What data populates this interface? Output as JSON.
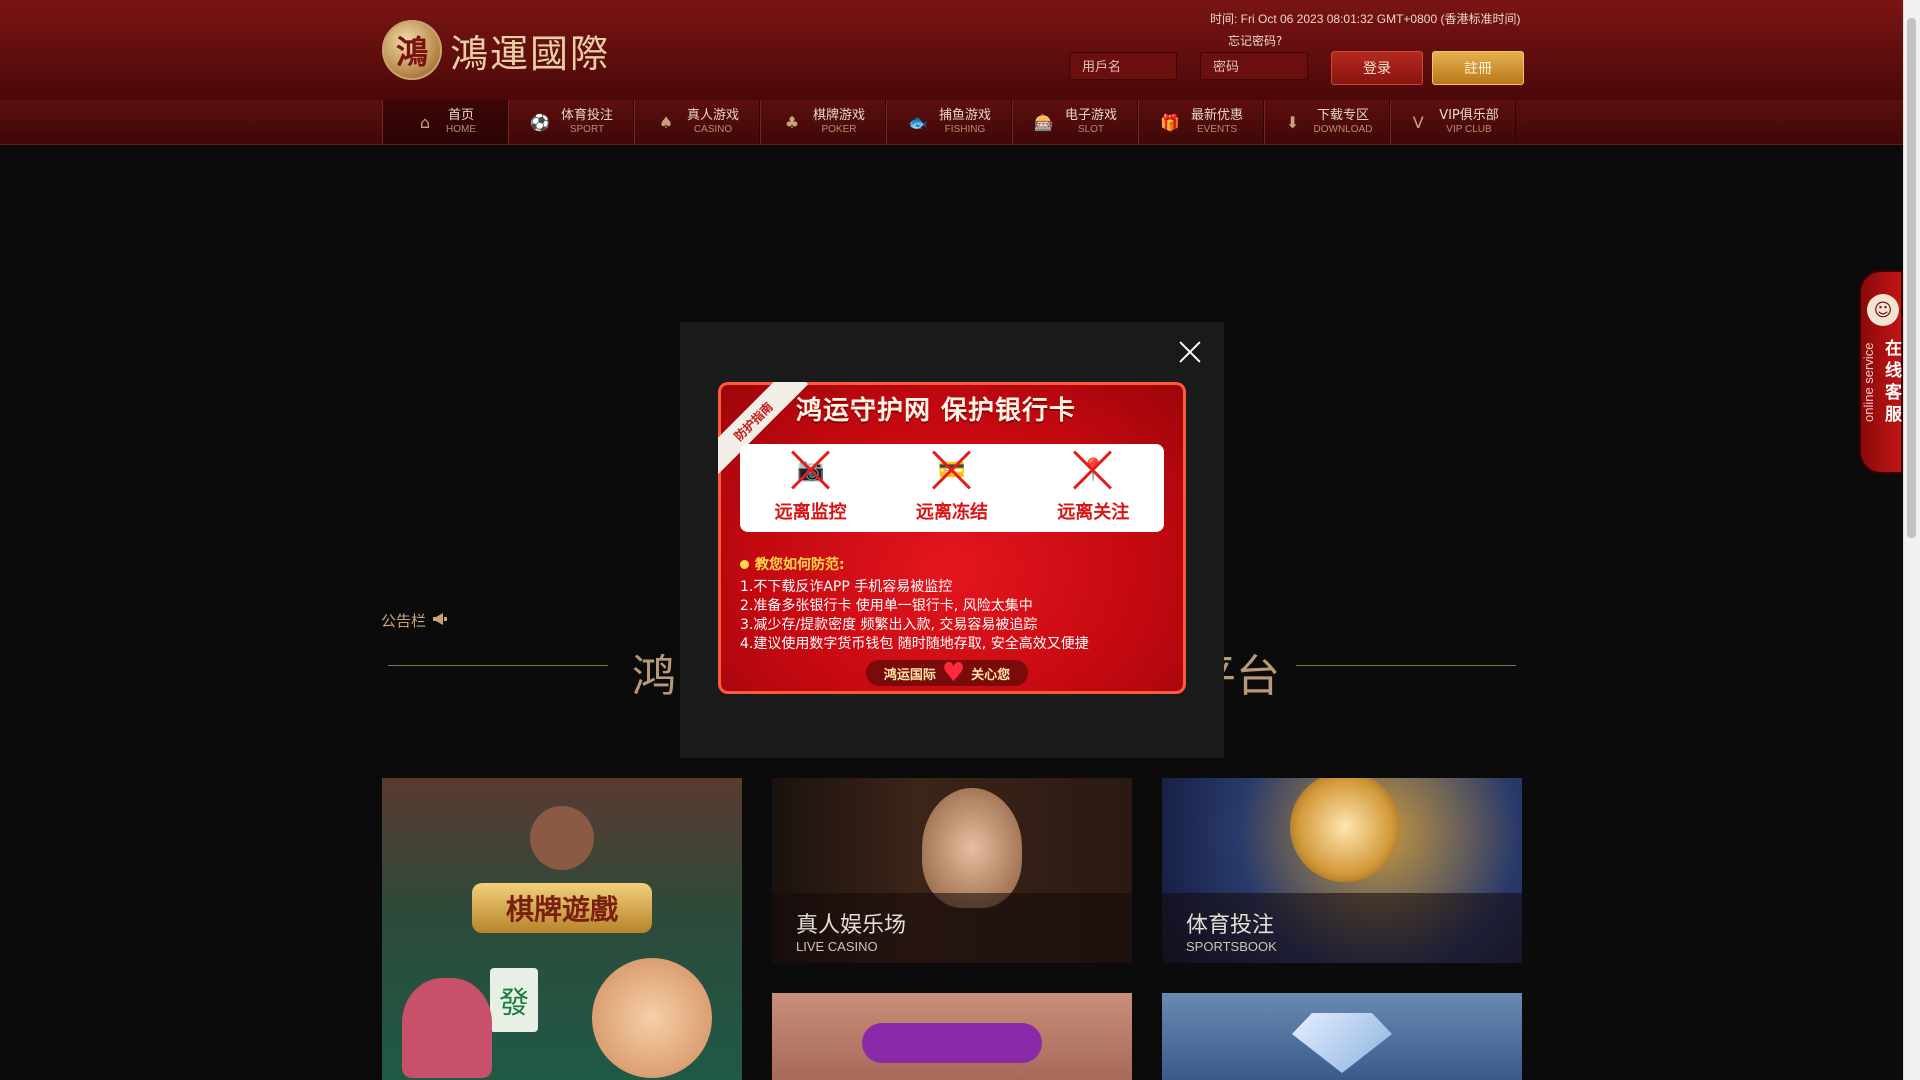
{
  "header": {
    "logo_seal": "鴻",
    "logo_text": "鴻運國際",
    "time_text": "时间: Fri Oct 06 2023 08:01:32 GMT+0800 (香港标准时间)",
    "forgot_label": "忘记密码?",
    "username_placeholder": "用戶名",
    "password_placeholder": "密码",
    "login_label": "登录",
    "register_label": "註冊"
  },
  "nav": [
    {
      "cn": "首页",
      "en": "HOME",
      "icon": "home-icon",
      "glyph": "⌂"
    },
    {
      "cn": "体育投注",
      "en": "SPORT",
      "icon": "sport-icon",
      "glyph": "⚽"
    },
    {
      "cn": "真人游戏",
      "en": "CASINO",
      "icon": "casino-icon",
      "glyph": "♠"
    },
    {
      "cn": "棋牌游戏",
      "en": "POKER",
      "icon": "poker-icon",
      "glyph": "♣"
    },
    {
      "cn": "捕鱼游戏",
      "en": "FISHING",
      "icon": "fishing-icon",
      "glyph": "🐟"
    },
    {
      "cn": "电子游戏",
      "en": "SLOT",
      "icon": "slot-icon",
      "glyph": "🎰"
    },
    {
      "cn": "最新优惠",
      "en": "EVENTS",
      "icon": "gift-icon",
      "glyph": "🎁"
    },
    {
      "cn": "下载专区",
      "en": "DOWNLOAD",
      "icon": "download-icon",
      "glyph": "⬇"
    },
    {
      "cn": "VIP俱乐部",
      "en": "VIP CLUB",
      "icon": "vip-icon",
      "glyph": "V"
    }
  ],
  "notice": {
    "label": "公告栏",
    "icon": "megaphone-icon"
  },
  "title_visible": [
    "鸿",
    "平台"
  ],
  "tiles": [
    {
      "cn": "",
      "en": ""
    },
    {
      "cn": "真人娱乐场",
      "en": "LIVE CASINO"
    },
    {
      "cn": "体育投注",
      "en": "SPORTSBOOK"
    },
    {
      "cn": "",
      "en": ""
    },
    {
      "cn": "",
      "en": ""
    }
  ],
  "modal": {
    "ribbon": "防护指南",
    "poster_title": "鸿运守护网  保护银行卡",
    "cards": [
      {
        "label": "远离监控",
        "icon": "camera-icon"
      },
      {
        "label": "远离冻结",
        "icon": "card-icon"
      },
      {
        "label": "远离关注",
        "icon": "location-icon"
      }
    ],
    "guide_head": "教您如何防范:",
    "tips": [
      "1.不下载反诈APP 手机容易被监控",
      "2.准备多张银行卡 使用单一银行卡, 风险太集中",
      "3.减少存/提款密度 频繁出入款, 交易容易被追踪",
      "4.建议使用数字货币钱包 随时随地存取, 安全高效又便捷"
    ],
    "care_left": "鸿运国际",
    "care_right": "关心您"
  },
  "service": {
    "cn": "在线客服",
    "en": "online service"
  },
  "colors": {
    "header_red": "#7a1414",
    "gold": "#e6b04e",
    "poster_red": "#d30d16"
  }
}
